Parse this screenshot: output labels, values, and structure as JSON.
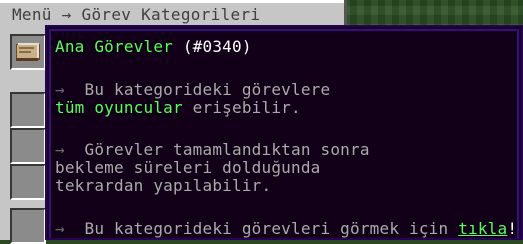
{
  "panel": {
    "title": "Menü → Görev Kategorileri"
  },
  "tooltip": {
    "title": "Ana Görevler",
    "id": "(#0340)",
    "arrow": "→",
    "para1_prefix": "Bu kategorideki görevlere",
    "para1_highlight": "tüm oyuncular",
    "para1_suffix": " erişebilir.",
    "para2_line1": "Görevler tamamlandıktan sonra",
    "para2_line2": "bekleme süreleri dolduğunda",
    "para2_line3": "tekrardan yapılabilir.",
    "para3_prefix": "Bu kategorideki görevleri görmek için",
    "para3_link": "tıkla",
    "para3_suffix": "!"
  },
  "icons": {
    "slot1": "book-icon"
  }
}
